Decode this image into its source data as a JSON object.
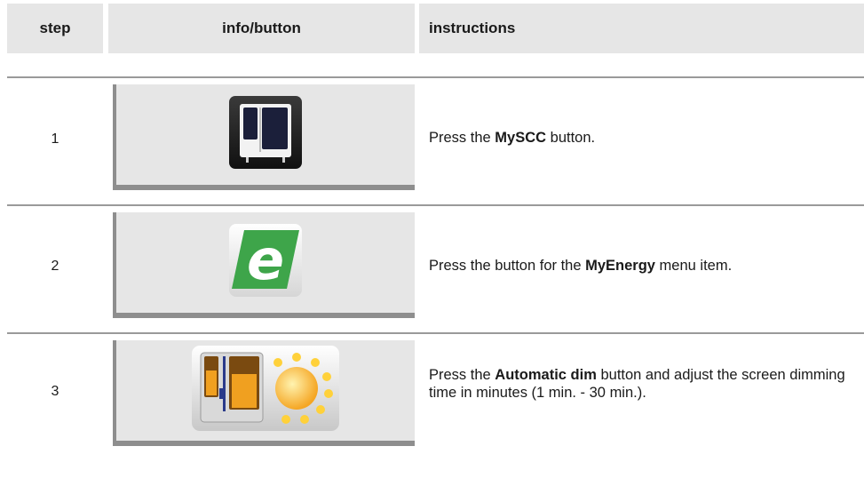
{
  "header": {
    "step": "step",
    "info": "info/button",
    "instructions": "instructions"
  },
  "rows": [
    {
      "step": "1",
      "icon": "myscc-oven-icon",
      "text_before": "Press the ",
      "text_bold": "MySCC",
      "text_after": " button."
    },
    {
      "step": "2",
      "icon": "myenergy-e-icon",
      "text_before": "Press the button for the ",
      "text_bold": "MyEnergy",
      "text_after": " menu item."
    },
    {
      "step": "3",
      "icon": "automatic-dim-icon",
      "text_before": "Press the ",
      "text_bold": "Automatic dim",
      "text_after": " button and adjust the screen dimming time in minutes (1 min. - 30 min.)."
    }
  ],
  "colors": {
    "header_bg": "#e6e6e6",
    "panel_bg": "#e6e6e6",
    "panel_shadow": "#8e8e8e",
    "energy_green": "#3ea54a",
    "sun_orange": "#f5a623"
  }
}
